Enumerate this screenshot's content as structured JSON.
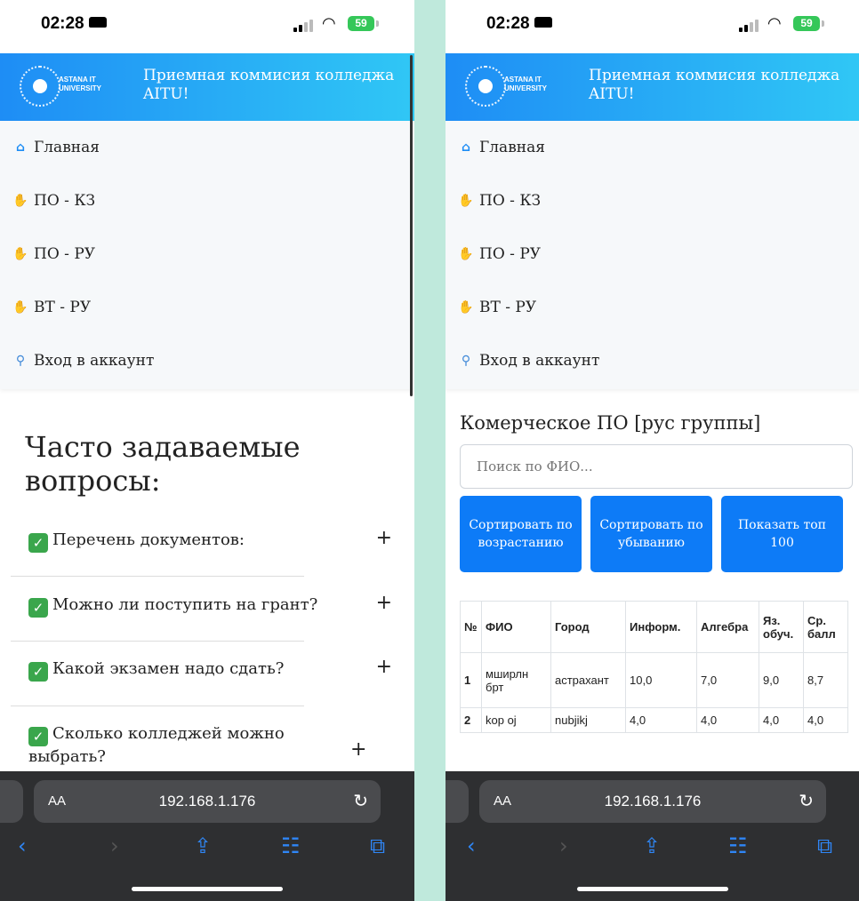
{
  "status": {
    "time": "02:28",
    "battery": "59"
  },
  "header": {
    "logo_line1": "ASTANA IT",
    "logo_line2": "UNIVERSITY",
    "title": "Приемная коммисия колледжа AITU!"
  },
  "nav": [
    {
      "icon": "home-icon",
      "label": "Главная"
    },
    {
      "icon": "hand-icon",
      "label": "ПО - КЗ"
    },
    {
      "icon": "hand-icon",
      "label": "ПО - РУ"
    },
    {
      "icon": "hand-icon",
      "label": "ВТ - РУ"
    },
    {
      "icon": "search-icon",
      "label": "Вход в аккаунт"
    }
  ],
  "faq": {
    "title": "Часто задаваемые вопросы:",
    "items": [
      {
        "text": "Перечень документов:"
      },
      {
        "text": "Можно ли поступить на грант?"
      },
      {
        "text": "Какой экзамен надо сдать?"
      },
      {
        "text": "Сколько колледжей можно выбрать?"
      }
    ]
  },
  "results": {
    "title": "Комерческое ПО [рус группы]",
    "search_placeholder": "Поиск по ФИО...",
    "buttons": [
      "Сортировать по возрастанию",
      "Сортировать по убыванию",
      "Показать топ 100"
    ],
    "columns": [
      "№",
      "ФИО",
      "Город",
      "Информ.",
      "Алгебра",
      "Яз. обуч.",
      "Ср. балл"
    ],
    "rows": [
      [
        "1",
        "мширлн брт",
        "астрахант",
        "10,0",
        "7,0",
        "9,0",
        "8,7"
      ],
      [
        "2",
        "kop oj",
        "nubjikj",
        "4,0",
        "4,0",
        "4,0",
        "4,0"
      ]
    ]
  },
  "browser": {
    "aa": "AA",
    "url": "192.168.1.176"
  },
  "colors": {
    "header_start": "#1e8df5",
    "header_end": "#30c7f5",
    "button": "#0d7bf7",
    "check": "#3aa64c",
    "battery": "#35c759"
  }
}
